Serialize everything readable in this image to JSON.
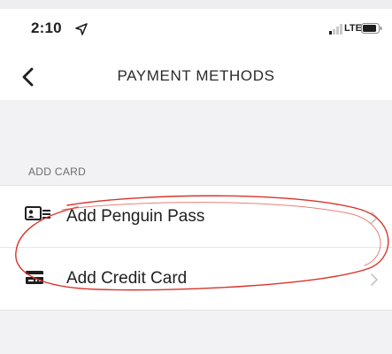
{
  "status_bar": {
    "time": "2:10",
    "network": "LTE",
    "icons": [
      "location-arrow-icon",
      "signal-icon",
      "battery-icon"
    ]
  },
  "header": {
    "title": "PAYMENT METHODS",
    "back_icon": "chevron-left-icon"
  },
  "section": {
    "header": "ADD CARD",
    "items": [
      {
        "label": "Add Penguin Pass",
        "icon": "id-card-icon"
      },
      {
        "label": "Add Credit Card",
        "icon": "credit-card-icon"
      }
    ]
  },
  "colors": {
    "background": "#f2f2f4",
    "surface": "#ffffff",
    "annotation": "#d9342b"
  }
}
